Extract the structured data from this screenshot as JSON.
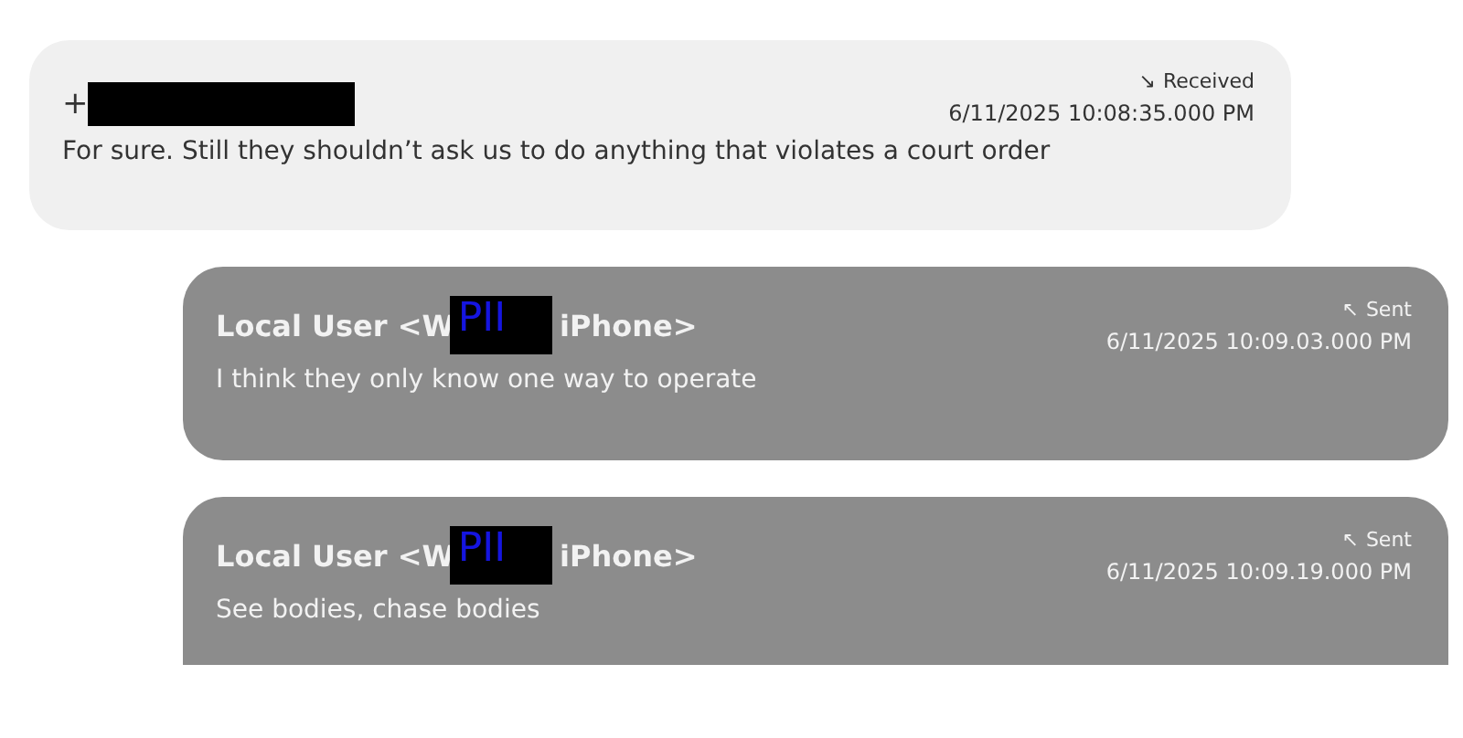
{
  "messages": [
    {
      "kind": "received",
      "status_icon": "↘",
      "status": "Received",
      "sender": [
        {
          "kind": "text",
          "text": "+"
        },
        {
          "kind": "redaction"
        }
      ],
      "timestamp": "6/11/2025 10:08:35.000 PM",
      "body": "For sure. Still they shouldn’t ask us to do anything that violates a court order"
    },
    {
      "kind": "sent",
      "status_icon": "↖",
      "status": "Sent",
      "sender": [
        {
          "kind": "text",
          "text": "Local User <W"
        },
        {
          "kind": "redaction",
          "text": "PII"
        },
        {
          "kind": "text",
          "text": " iPhone>"
        }
      ],
      "timestamp": "6/11/2025 10:09.03.000 PM",
      "body": "I think they only know one way to operate"
    },
    {
      "kind": "sent",
      "status_icon": "↖",
      "status": "Sent",
      "sender": [
        {
          "kind": "text",
          "text": "Local User <W"
        },
        {
          "kind": "redaction",
          "text": "PII"
        },
        {
          "kind": "text",
          "text": " iPhone>"
        }
      ],
      "timestamp": "6/11/2025 10:09.19.000 PM",
      "body": "See bodies, chase bodies"
    }
  ]
}
